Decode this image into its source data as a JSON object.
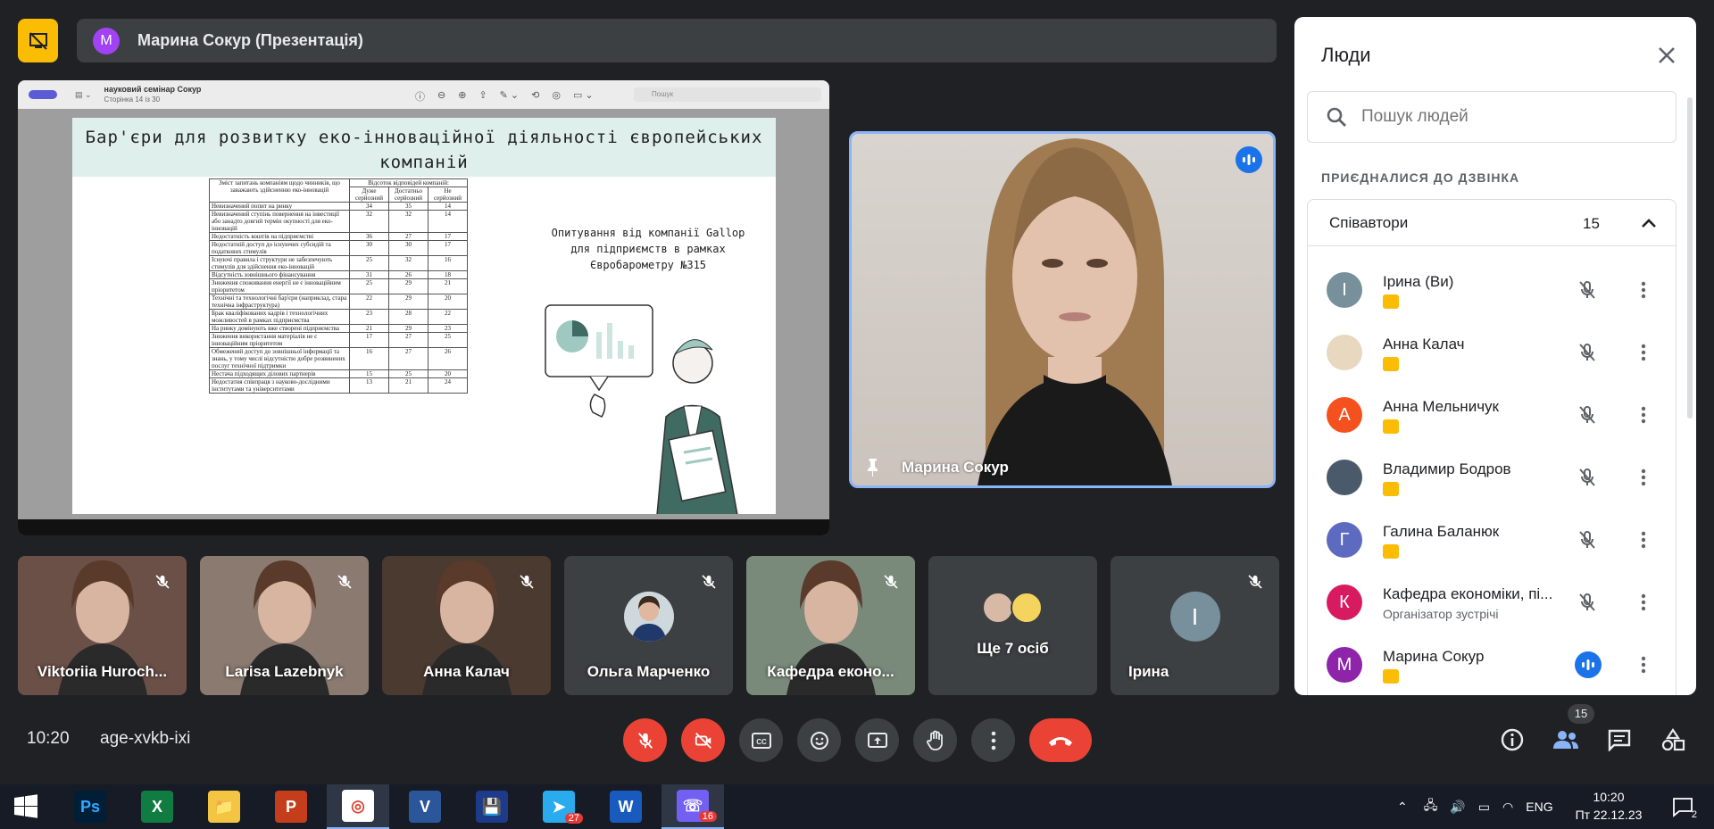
{
  "presenter_bar": {
    "avatar_letter": "M",
    "title": "Марина Сокур (Презентація)"
  },
  "presentation": {
    "doc_title": "науковий семінар Сокур",
    "page_info": "Сторінка 14 із 30",
    "search_placeholder": "Пошук",
    "slide_title": "Бар'єри для розвитку еко-інноваційної діяльності європейських компаній",
    "survey_text": "Опитування від компанії Gallop для підприємств в рамках Євробарометру №315",
    "table": {
      "header_question": "Зміст запитань компаніям щодо чинників, що заважають здійсненню еко-інновацій",
      "header_percent": "Відсоток відповідей компаній:",
      "col_very": "Дуже серйозний",
      "col_enough": "Достатньо серйозний",
      "col_not": "Не серйозний",
      "rows": [
        [
          "Невизначений попит на ринку",
          "34",
          "35",
          "14"
        ],
        [
          "Невизначений ступінь повернення на інвестиції або занадто довгий термін окупності для еко-інновацій",
          "32",
          "32",
          "14"
        ],
        [
          "Недостатність коштів на підприємстві",
          "36",
          "27",
          "17"
        ],
        [
          "Недостатній доступ до існуючих субсидій та податкових стимулів",
          "30",
          "30",
          "17"
        ],
        [
          "Існуючі правила і структури не забезпечують стимулів для здійснення еко-інновацій",
          "25",
          "32",
          "16"
        ],
        [
          "Відсутність зовнішнього фінансування",
          "31",
          "26",
          "18"
        ],
        [
          "Зниження споживання енергії не є інноваційним пріоритетом",
          "25",
          "29",
          "21"
        ],
        [
          "Технічні та технологічні бар'єри (наприклад, стара технічна інфраструктура)",
          "22",
          "29",
          "20"
        ],
        [
          "Брак кваліфікованих кадрів і технологічних можливостей в рамках підприємства",
          "23",
          "28",
          "22"
        ],
        [
          "На ринку домінують вже створені підприємства",
          "21",
          "29",
          "23"
        ],
        [
          "Зниження використання матеріалів не є інноваційним пріоритетом",
          "17",
          "27",
          "25"
        ],
        [
          "Обмежений доступ до зовнішньої інформації та знань, у тому числі відсутністю добре розвинених послуг технічної підтримки",
          "16",
          "27",
          "26"
        ],
        [
          "Нестача підходящих ділових партнерів",
          "15",
          "25",
          "20"
        ],
        [
          "Недостатня співпраця з науково-дослідними інститутами та університетами",
          "13",
          "21",
          "24"
        ]
      ]
    }
  },
  "main_video": {
    "name": "Марина Сокур"
  },
  "tiles": [
    {
      "name": "Viktoriia Huroch...",
      "type": "video",
      "bg": "#6b5048"
    },
    {
      "name": "Larisa Lazebnyk",
      "type": "video",
      "bg": "#8a7a70"
    },
    {
      "name": "Анна Калач",
      "type": "video",
      "bg": "#4a3a30"
    },
    {
      "name": "Ольга Марченко",
      "type": "photo",
      "bg": "#3c4043"
    },
    {
      "name": "Кафедра еконо...",
      "type": "video",
      "bg": "#7a8a7a"
    },
    {
      "name": "Ще 7 осіб",
      "type": "more",
      "bg": "#3c4043"
    },
    {
      "name": "Ірина",
      "type": "letter",
      "letter": "І",
      "bg": "#3c4043",
      "avatar_color": "#78909c"
    }
  ],
  "controls": {
    "time": "10:20",
    "meeting_code": "age-xvkb-ixi",
    "people_count": "15"
  },
  "panel": {
    "title": "Люди",
    "search_placeholder": "Пошук людей",
    "joined_label": "ПРИЄДНАЛИСЯ ДО ДЗВІНКА",
    "group_label": "Співавтори",
    "group_count": "15",
    "people": [
      {
        "name": "Ірина (Ви)",
        "letter": "І",
        "color": "#78909c",
        "sub": ""
      },
      {
        "name": "Анна Калач",
        "letter": "",
        "color": "#e8d8c0",
        "sub": ""
      },
      {
        "name": "Анна Мельничук",
        "letter": "А",
        "color": "#f4511e",
        "sub": ""
      },
      {
        "name": "Владимир Бодров",
        "letter": "",
        "color": "#4a5a6a",
        "sub": ""
      },
      {
        "name": "Галина Баланюк",
        "letter": "Г",
        "color": "#5c6bc0",
        "sub": ""
      },
      {
        "name": "Кафедра економіки, пі...",
        "letter": "К",
        "color": "#d81b60",
        "sub": "Організатор зустрічі"
      },
      {
        "name": "Марина Сокур",
        "letter": "M",
        "color": "#8e24aa",
        "sub": ""
      }
    ]
  },
  "taskbar": {
    "apps": [
      {
        "label": "Ps",
        "color": "#001e36",
        "text_color": "#31a8ff"
      },
      {
        "label": "X",
        "color": "#107c41",
        "text_color": "#fff"
      },
      {
        "label": "📁",
        "color": "#f4c542",
        "text_color": "#fff"
      },
      {
        "label": "P",
        "color": "#c43e1c",
        "text_color": "#fff"
      },
      {
        "label": "◎",
        "color": "#ffffff",
        "text_color": "#db4437"
      },
      {
        "label": "V",
        "color": "#2b579a",
        "text_color": "#fff"
      },
      {
        "label": "💾",
        "color": "#1e3a8a",
        "text_color": "#fff"
      },
      {
        "label": "➤",
        "color": "#2aabee",
        "text_color": "#fff",
        "badge": "27"
      },
      {
        "label": "W",
        "color": "#185abd",
        "text_color": "#fff"
      },
      {
        "label": "☏",
        "color": "#7360f2",
        "text_color": "#fff",
        "badge": "16"
      }
    ],
    "lang": "ENG",
    "time": "10:20",
    "date": "Пт 22.12.23",
    "notification_count": "2"
  }
}
